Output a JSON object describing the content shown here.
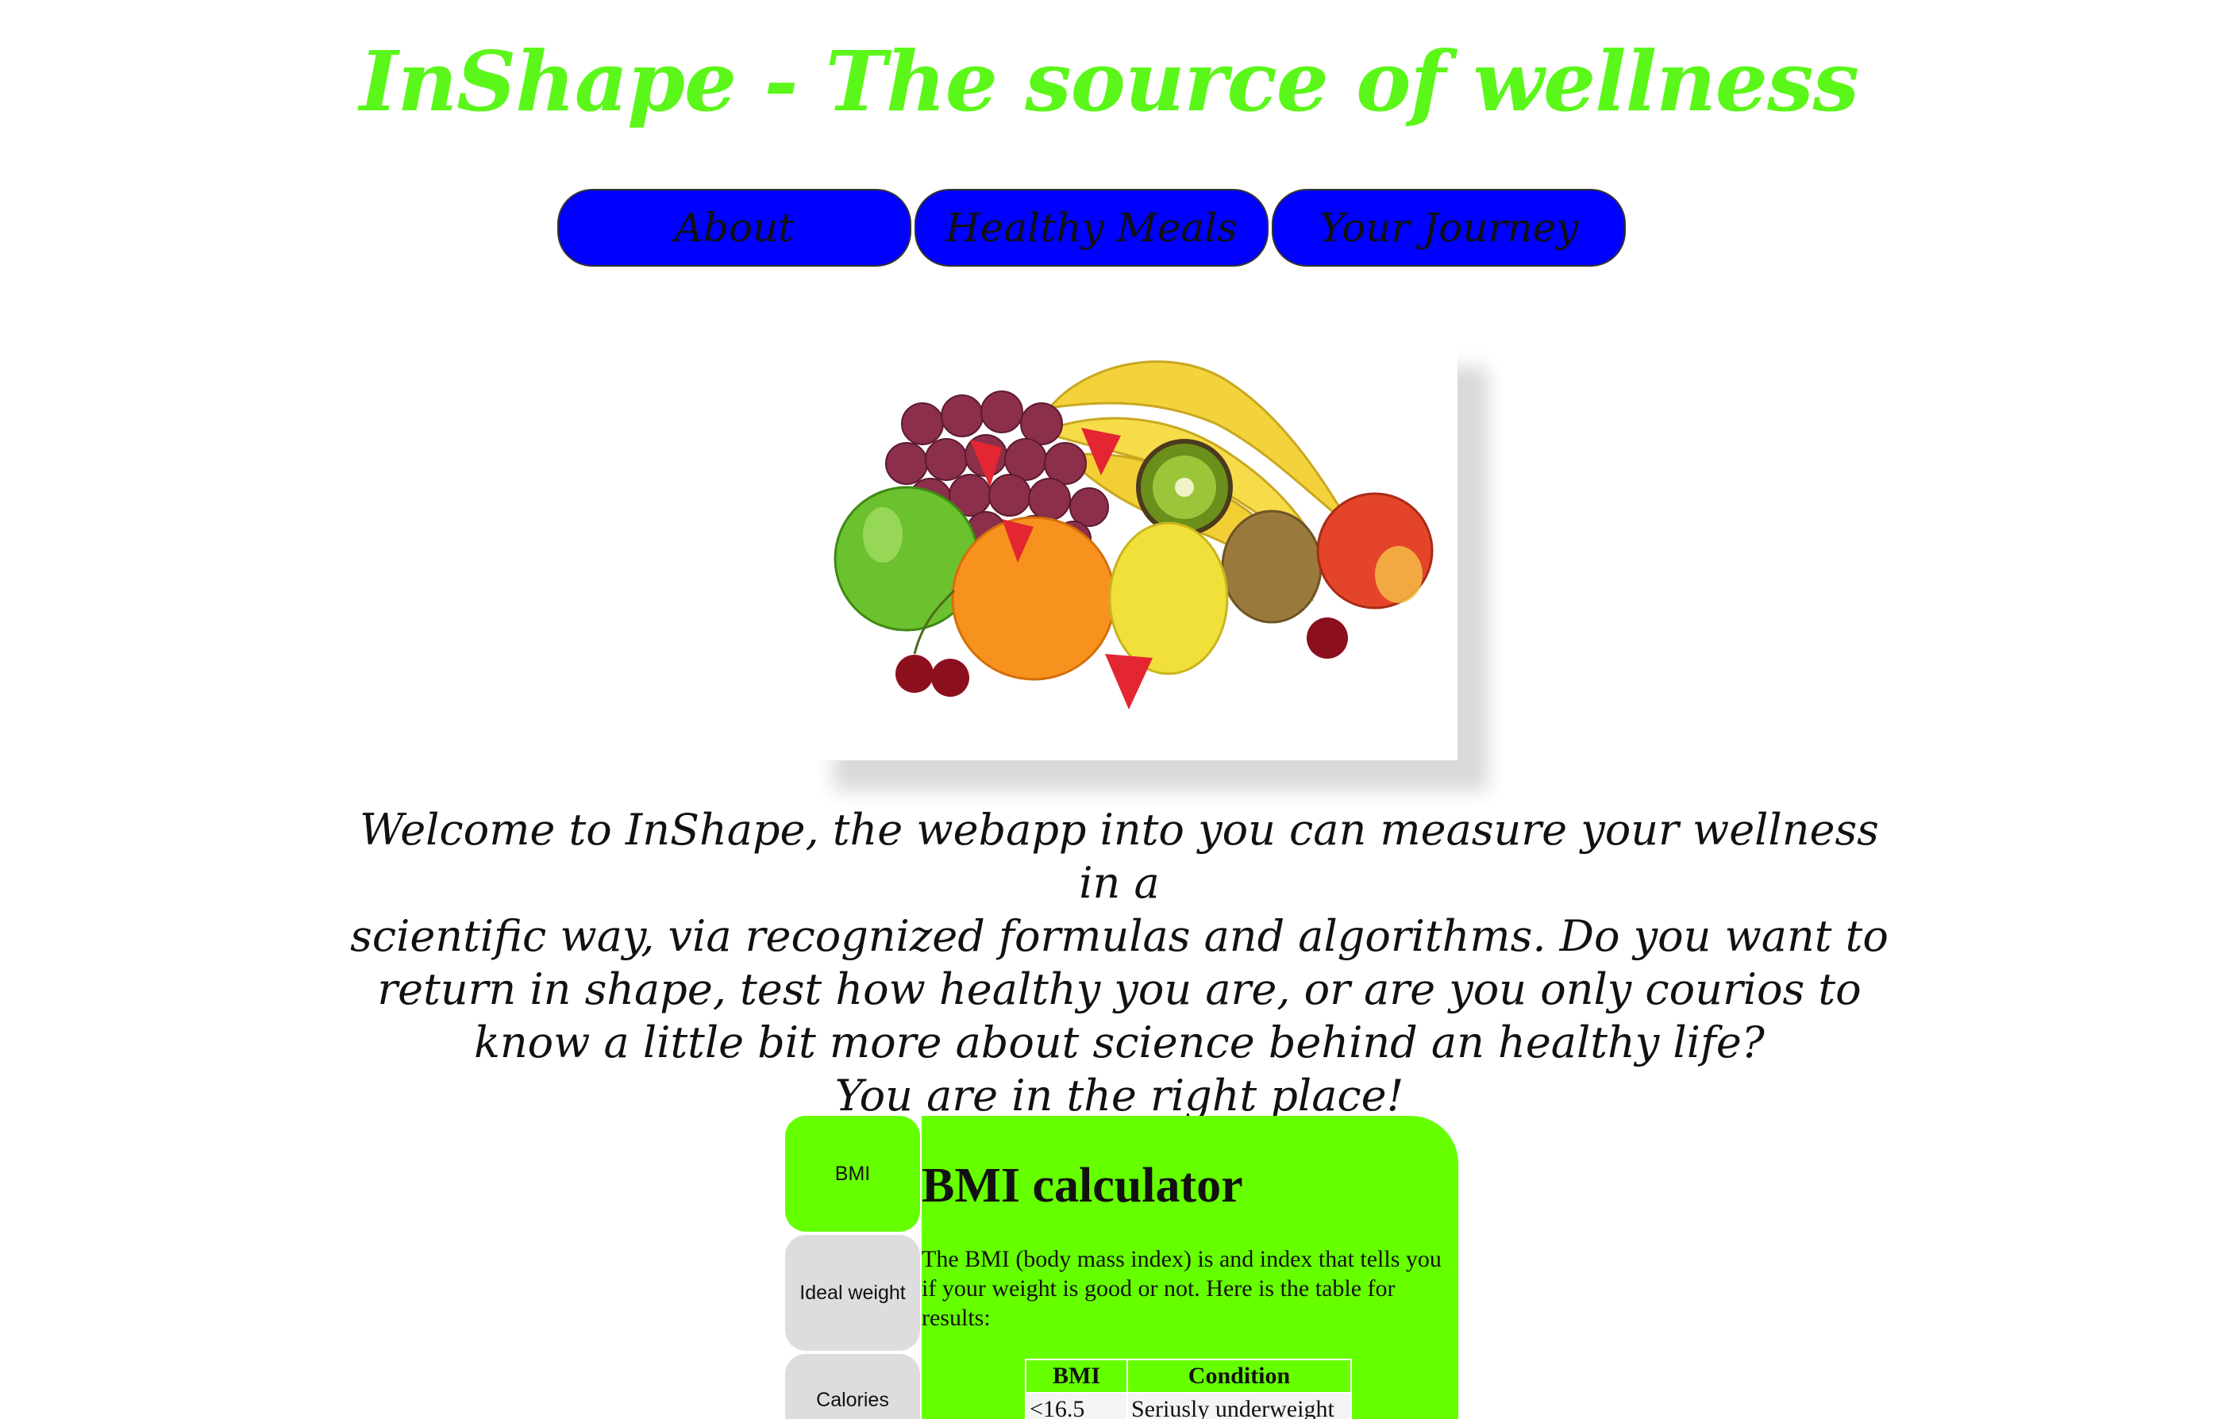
{
  "header": {
    "title": "InShape - The source of wellness"
  },
  "nav": {
    "items": [
      {
        "label": "About"
      },
      {
        "label": "Healthy Meals"
      },
      {
        "label": "Your Journey"
      }
    ]
  },
  "hero": {
    "image": "fruit-assortment-image"
  },
  "welcome": {
    "lines": [
      "Welcome to InShape, the webapp into you can measure your wellness in a",
      "scientific way, via recognized formulas and algorithms. Do you want to",
      "return in shape, test how healthy you are, or are you only courios to",
      "know a little bit more about science behind an healthy life?",
      "You are in the right place!"
    ]
  },
  "calculator_tabs": {
    "items": [
      {
        "label": "BMI",
        "active": true
      },
      {
        "label": "Ideal weight",
        "active": false
      },
      {
        "label": "Calories",
        "active": false
      }
    ]
  },
  "bmi_panel": {
    "heading": "BMI calculator",
    "description": "The BMI (body mass index) is and index that tells you if your weight is good or not. Here is the table for results:",
    "table": {
      "headers": [
        "BMI",
        "Condition"
      ],
      "rows": [
        [
          "<16.5",
          "Seriusly underweight"
        ]
      ]
    }
  },
  "colors": {
    "title": "#5cf71a",
    "nav_button": "#0000ff",
    "accent_green": "#66ff00",
    "inactive_tab": "#dddddd"
  }
}
